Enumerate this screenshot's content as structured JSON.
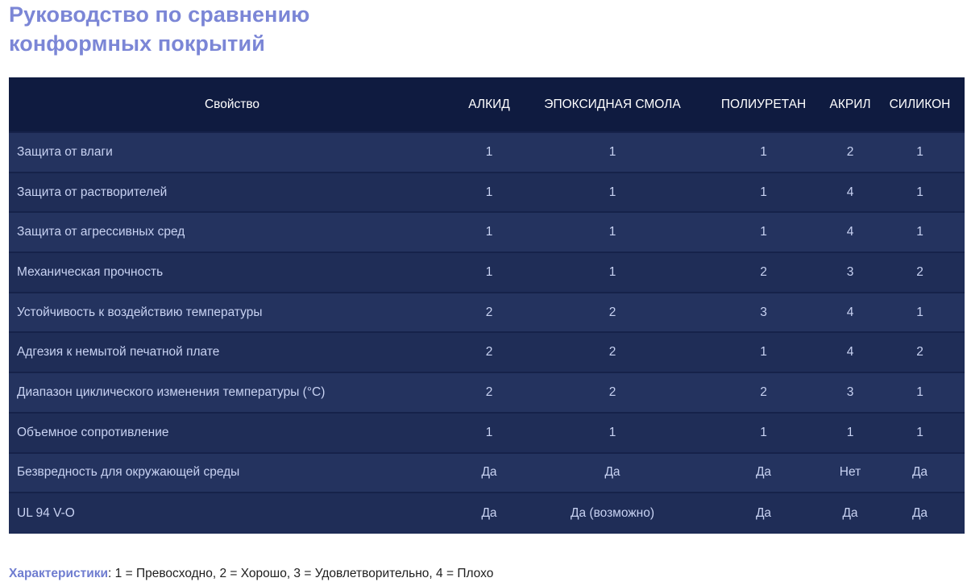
{
  "title": {
    "line1": "Руководство по сравнению",
    "line2": "конформных покрытий"
  },
  "table": {
    "headers": [
      "Свойство",
      "АЛКИД",
      "ЭПОКСИДНАЯ СМОЛА",
      "ПОЛИУРЕТАН",
      "АКРИЛ",
      "СИЛИКОН"
    ],
    "rows": [
      [
        "Защита от влаги",
        "1",
        "1",
        "1",
        "2",
        "1"
      ],
      [
        "Защита от растворителей",
        "1",
        "1",
        "1",
        "4",
        "1"
      ],
      [
        "Защита от агрессивных сред",
        "1",
        "1",
        "1",
        "4",
        "1"
      ],
      [
        "Механическая прочность",
        "1",
        "1",
        "2",
        "3",
        "2"
      ],
      [
        "Устойчивость к воздействию температуры",
        "2",
        "2",
        "3",
        "4",
        "1"
      ],
      [
        "Адгезия к немытой печатной плате",
        "2",
        "2",
        "1",
        "4",
        "2"
      ],
      [
        "Диапазон циклического изменения температуры (°C)",
        "2",
        "2",
        "2",
        "3",
        "1"
      ],
      [
        "Объемное сопротивление",
        "1",
        "1",
        "1",
        "1",
        "1"
      ],
      [
        "Безвредность для окружающей среды",
        "Да",
        "Да",
        "Да",
        "Нет",
        "Да"
      ],
      [
        "UL 94 V-O",
        "Да",
        "Да (возможно)",
        "Да",
        "Да",
        "Да"
      ]
    ]
  },
  "legend": {
    "label": "Характеристики",
    "text": ": 1 = Превосходно, 2 = Хорошо, 3 = Удовлетворительно, 4 = Плохо"
  },
  "colors": {
    "title": "#7b86d6",
    "header_bg": "#0f1b40",
    "row_bg": "#24335f",
    "row_text": "#c8d2f2",
    "legend_label": "#6f7dd0"
  }
}
